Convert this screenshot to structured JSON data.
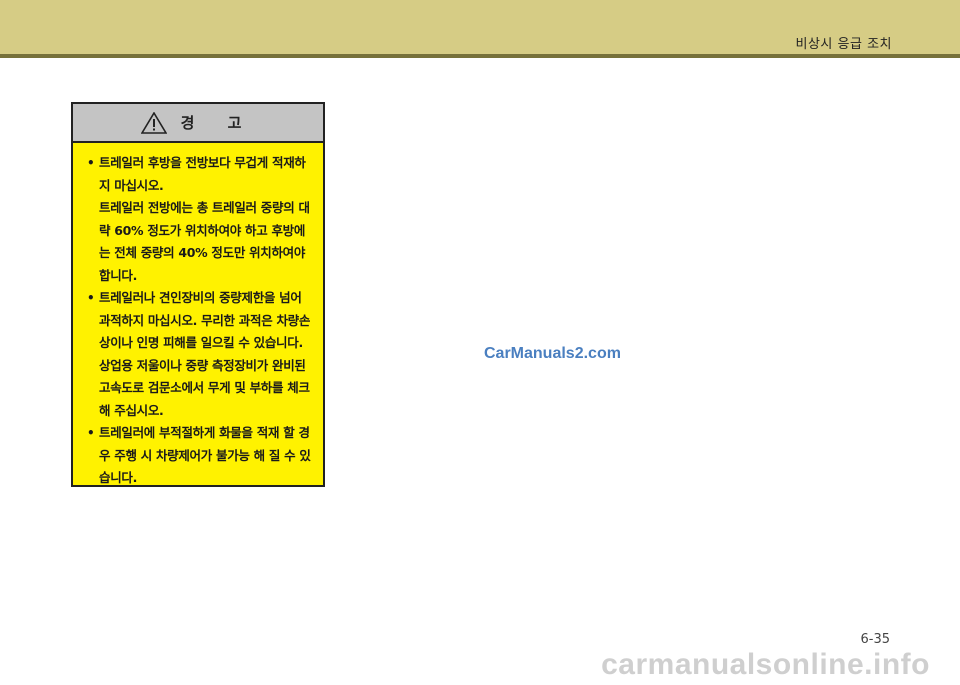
{
  "header": {
    "section_title": "비상시 응급 조치",
    "band_color": "#d6cc85",
    "rule_color": "#77713a"
  },
  "warning": {
    "icon": "warning-triangle-icon",
    "title": "경 고",
    "background_color": "#fff200",
    "header_color": "#c4c4c4",
    "items": [
      {
        "paragraphs": [
          "트레일러 후방을 전방보다 무겁게 적재하지 마십시오.",
          "트레일러 전방에는 총 트레일러 중량의 대략 60% 정도가 위치하여야 하고 후방에는 전체 중량의 40% 정도만 위치하여야 합니다."
        ]
      },
      {
        "paragraphs": [
          "트레일러나 견인장비의 중량제한을 넘어 과적하지 마십시오. 무리한 과적은 차량손상이나 인명 피해를 일으킬 수 있습니다. 상업용 저울이나 중량 측정장비가 완비된 고속도로 검문소에서 무게 및 부하를 체크해 주십시오."
        ]
      },
      {
        "paragraphs": [
          "트레일러에 부적절하게 화물을 적재 할 경우 주행 시 차량제어가 불가능 해 질 수 있습니다."
        ]
      }
    ]
  },
  "watermark_brand": "CarManuals2.com",
  "page_number": "6-35",
  "watermark_site": "carmanualsonline.info"
}
